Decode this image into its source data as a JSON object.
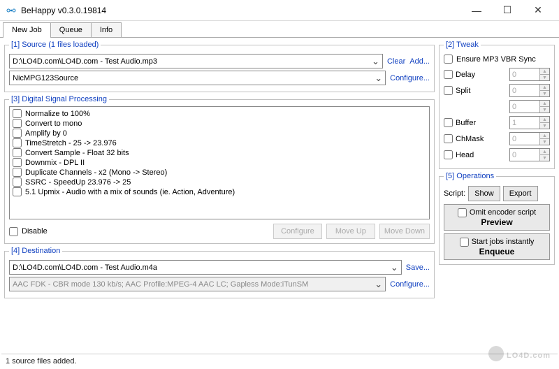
{
  "app": {
    "title": "BeHappy v0.3.0.19814"
  },
  "tabs": {
    "items": [
      "New Job",
      "Queue",
      "Info"
    ],
    "active": 0
  },
  "source": {
    "legend": "[1] Source  (1 files loaded)",
    "file": "D:\\LO4D.com\\LO4D.com - Test Audio.mp3",
    "clear": "Clear",
    "add": "Add...",
    "decoder": "NicMPG123Source",
    "configure": "Configure..."
  },
  "dsp": {
    "legend": "[3] Digital Signal Processing",
    "items": [
      "Normalize to 100%",
      "Convert to mono",
      "Amplify by 0",
      "TimeStretch - 25 -> 23.976",
      "Convert Sample - Float 32 bits",
      "Downmix - DPL II",
      "Duplicate Channels - x2 (Mono -> Stereo)",
      "SSRC - SpeedUp 23.976 -> 25",
      "5.1 Upmix - Audio with a mix of sounds (ie. Action, Adventure)"
    ],
    "disable": "Disable",
    "configure_btn": "Configure",
    "moveup_btn": "Move Up",
    "movedown_btn": "Move Down"
  },
  "dest": {
    "legend": "[4] Destination",
    "file": "D:\\LO4D.com\\LO4D.com - Test Audio.m4a",
    "save": "Save...",
    "encoder": "AAC FDK - CBR mode 130 kb/s; AAC Profile:MPEG-4 AAC LC; Gapless Mode:iTunSM",
    "configure": "Configure..."
  },
  "tweak": {
    "legend": "[2] Tweak",
    "ensure": "Ensure MP3 VBR Sync",
    "delay_label": "Delay",
    "delay_val": "0",
    "split_label": "Split",
    "split_val1": "0",
    "split_val2": "0",
    "buffer_label": "Buffer",
    "buffer_val": "1",
    "chmask_label": "ChMask",
    "chmask_val": "0",
    "head_label": "Head",
    "head_val": "0"
  },
  "ops": {
    "legend": "[5] Operations",
    "script_label": "Script:",
    "show": "Show",
    "export": "Export",
    "omit": "Omit encoder script",
    "preview": "Preview",
    "instant": "Start jobs instantly",
    "enqueue": "Enqueue"
  },
  "status": "1 source files added.",
  "watermark": "LO4D.com"
}
